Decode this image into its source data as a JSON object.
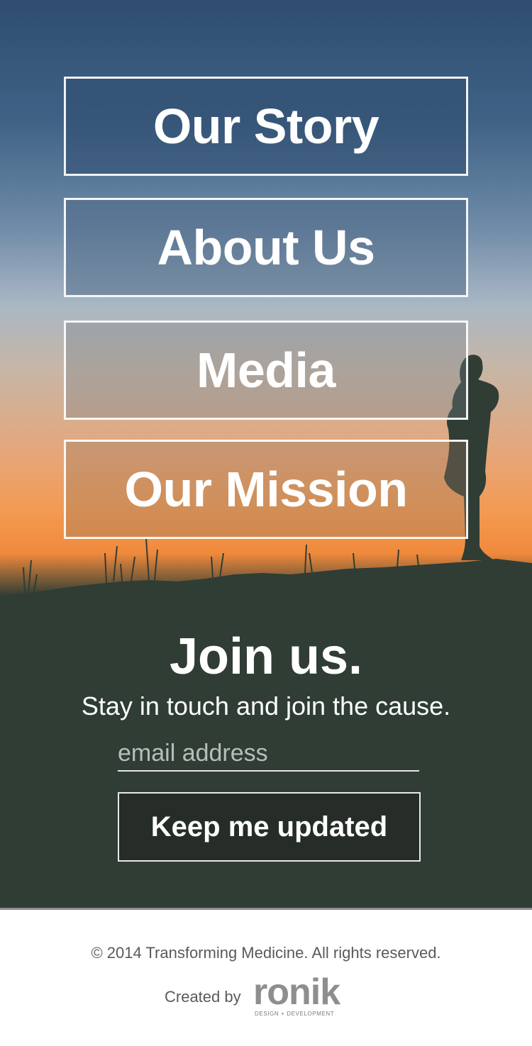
{
  "nav": {
    "items": [
      {
        "label": "Our Story"
      },
      {
        "label": "About Us"
      },
      {
        "label": "Media"
      },
      {
        "label": "Our Mission"
      }
    ]
  },
  "signup": {
    "title": "Join us.",
    "subtitle": "Stay in touch and join the cause.",
    "email_placeholder": "email address",
    "email_value": "",
    "button_label": "Keep me updated"
  },
  "footer": {
    "copyright": "© 2014 Transforming Medicine. All rights reserved.",
    "created_by": "Created by",
    "logo_text": "ronik",
    "logo_tagline": "DESIGN + DEVELOPMENT"
  },
  "colors": {
    "sky_top": "#2f4d70",
    "sunset_orange": "#f08a3c",
    "ground": "#2f3d35",
    "button_bg": "#262d28",
    "logo": "#8e8e8e"
  }
}
